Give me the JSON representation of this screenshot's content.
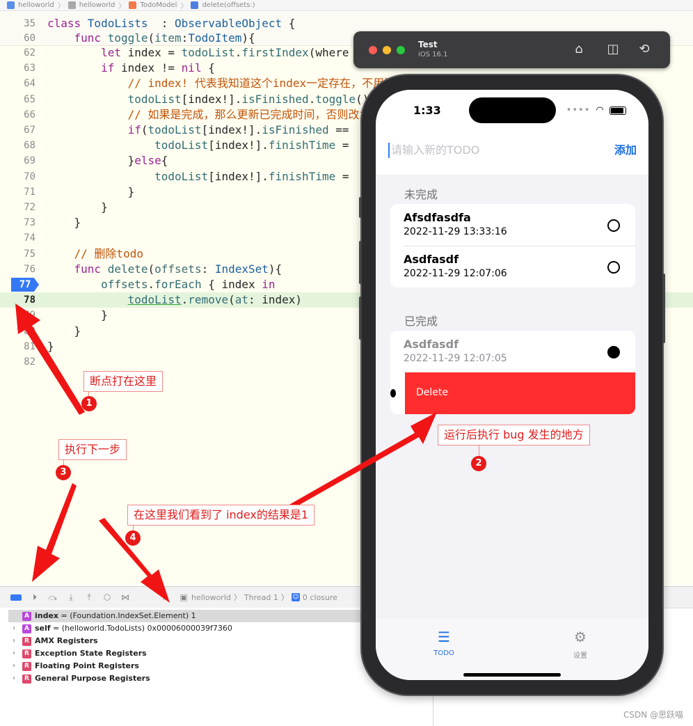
{
  "breadcrumb": {
    "items": [
      "helloworld",
      "helloworld",
      "TodoModel",
      "delete(offsets:)"
    ]
  },
  "editor": {
    "sticky_lines": [
      {
        "num": "35",
        "tokens": [
          [
            "kw",
            "class "
          ],
          [
            "ty",
            "TodoLists"
          ],
          [
            "",
            "  : "
          ],
          [
            "ty",
            "ObservableObject"
          ],
          [
            "",
            " {"
          ]
        ]
      },
      {
        "num": "60",
        "tokens": [
          [
            "",
            "    "
          ],
          [
            "kw",
            "func "
          ],
          [
            "fn",
            "toggle"
          ],
          [
            "",
            "("
          ],
          [
            "pm",
            "item"
          ],
          [
            "",
            ":"
          ],
          [
            "ty",
            "TodoItem"
          ],
          [
            "",
            "){"
          ]
        ]
      }
    ],
    "lines": [
      {
        "num": "62",
        "tokens": [
          [
            "",
            "        "
          ],
          [
            "kw",
            "let "
          ],
          [
            "",
            "index = "
          ],
          [
            "fn",
            "todoList"
          ],
          [
            "",
            "."
          ],
          [
            "fn",
            "firstIndex"
          ],
          [
            "",
            "(where"
          ]
        ]
      },
      {
        "num": "63",
        "tokens": [
          [
            "",
            "        "
          ],
          [
            "kw",
            "if "
          ],
          [
            "",
            "index != "
          ],
          [
            "kw",
            "nil"
          ],
          [
            "",
            " {"
          ]
        ]
      },
      {
        "num": "64",
        "tokens": [
          [
            "",
            "            "
          ],
          [
            "cm",
            "// index! 代表我知道这个index一定存在，不用再进行判断"
          ]
        ]
      },
      {
        "num": "65",
        "tokens": [
          [
            "",
            "            "
          ],
          [
            "fn",
            "todoList"
          ],
          [
            "",
            "[index!]."
          ],
          [
            "fn",
            "isFinished"
          ],
          [
            "",
            "."
          ],
          [
            "fn",
            "toggle"
          ],
          [
            "",
            "()"
          ]
        ]
      },
      {
        "num": "66",
        "tokens": [
          [
            "",
            "            "
          ],
          [
            "cm",
            "// 如果是完成，那么更新已完成时间，否则改为"
          ]
        ]
      },
      {
        "num": "67",
        "tokens": [
          [
            "",
            "            "
          ],
          [
            "kw",
            "if"
          ],
          [
            "",
            "("
          ],
          [
            "fn",
            "todoList"
          ],
          [
            "",
            "[index!]."
          ],
          [
            "fn",
            "isFinished"
          ],
          [
            "",
            " =="
          ]
        ]
      },
      {
        "num": "68",
        "tokens": [
          [
            "",
            "                "
          ],
          [
            "fn",
            "todoList"
          ],
          [
            "",
            "[index!]."
          ],
          [
            "fn",
            "finishTime"
          ],
          [
            "",
            " ="
          ]
        ]
      },
      {
        "num": "69",
        "tokens": [
          [
            "",
            "            "
          ],
          [
            "",
            "}"
          ],
          [
            "kw",
            "else"
          ],
          [
            "",
            "{"
          ]
        ]
      },
      {
        "num": "70",
        "tokens": [
          [
            "",
            "                "
          ],
          [
            "fn",
            "todoList"
          ],
          [
            "",
            "[index!]."
          ],
          [
            "fn",
            "finishTime"
          ],
          [
            "",
            " ="
          ]
        ]
      },
      {
        "num": "71",
        "tokens": [
          [
            "",
            "            }"
          ]
        ]
      },
      {
        "num": "72",
        "tokens": [
          [
            "",
            "        }"
          ]
        ]
      },
      {
        "num": "73",
        "tokens": [
          [
            "",
            "    }"
          ]
        ]
      },
      {
        "num": "74",
        "tokens": [
          [
            "",
            ""
          ]
        ]
      },
      {
        "num": "75",
        "tokens": [
          [
            "",
            "    "
          ],
          [
            "cm",
            "// 删除todo"
          ]
        ]
      },
      {
        "num": "76",
        "tokens": [
          [
            "",
            "    "
          ],
          [
            "kw",
            "func "
          ],
          [
            "fn",
            "delete"
          ],
          [
            "",
            "("
          ],
          [
            "pm",
            "offsets"
          ],
          [
            "",
            ": "
          ],
          [
            "ty",
            "IndexSet"
          ],
          [
            "",
            "){"
          ]
        ]
      },
      {
        "num": "77",
        "tokens": [
          [
            "",
            "        "
          ],
          [
            "fn",
            "offsets"
          ],
          [
            "",
            "."
          ],
          [
            "fn",
            "forEach"
          ],
          [
            "",
            " { index "
          ],
          [
            "kw",
            "in"
          ]
        ]
      },
      {
        "num": "78",
        "tokens": [
          [
            "",
            "            "
          ],
          [
            "fn",
            "todoList"
          ],
          [
            "",
            "."
          ],
          [
            "fn",
            "remove"
          ],
          [
            "",
            "("
          ],
          [
            "pm",
            "at"
          ],
          [
            "",
            ": index)"
          ]
        ]
      },
      {
        "num": "79",
        "tokens": [
          [
            "",
            "        }"
          ]
        ]
      },
      {
        "num": "80",
        "tokens": [
          [
            "",
            "    }"
          ]
        ]
      },
      {
        "num": "81",
        "tokens": [
          [
            "",
            "}"
          ]
        ]
      },
      {
        "num": "82",
        "tokens": [
          [
            "",
            ""
          ]
        ]
      }
    ],
    "breakpoint_line": "77",
    "current_line": "78"
  },
  "debug_toolbar": {
    "path": [
      "helloworld",
      "Thread 1",
      "0 closure"
    ]
  },
  "variables": [
    {
      "badge": "A",
      "color": "#b946d9",
      "name": "index",
      "value": " = (Foundation.IndexSet.Element) 1",
      "selected": true,
      "expandable": false
    },
    {
      "badge": "A",
      "color": "#b946d9",
      "name": "self",
      "value": " = (helloworld.TodoLists) 0x00006000039f7360",
      "selected": false,
      "expandable": true
    },
    {
      "badge": "R",
      "color": "#e0476a",
      "name": "AMX Registers",
      "value": "",
      "selected": false,
      "expandable": true
    },
    {
      "badge": "R",
      "color": "#e0476a",
      "name": "Exception State Registers",
      "value": "",
      "selected": false,
      "expandable": true
    },
    {
      "badge": "R",
      "color": "#e0476a",
      "name": "Floating Point Registers",
      "value": "",
      "selected": false,
      "expandable": true
    },
    {
      "badge": "R",
      "color": "#e0476a",
      "name": "General Purpose Registers",
      "value": "",
      "selected": false,
      "expandable": true
    }
  ],
  "simulator": {
    "title": "Test",
    "subtitle": "iOS 16.1",
    "status_time": "1:33",
    "input_placeholder": "请输入新的TODO",
    "add_label": "添加",
    "unfinished_header": "未完成",
    "finished_header": "已完成",
    "unfinished": [
      {
        "title": "Afsdfasdfa",
        "time": "2022-11-29 13:33:16"
      },
      {
        "title": "Asdfasdf",
        "time": "2022-11-29 12:07:06"
      }
    ],
    "finished": [
      {
        "title": "Asdfasdf",
        "time": "2022-11-29 12:07:05"
      }
    ],
    "delete_label": "Delete",
    "tabs": [
      {
        "label": "TODO",
        "icon": "list-icon",
        "active": true
      },
      {
        "label": "设置",
        "icon": "gear-icon",
        "active": false
      }
    ]
  },
  "annotations": {
    "note1": "断点打在这里",
    "note2": "运行后执行 bug 发生的地方",
    "note3": "执行下一步",
    "note4": "在这里我们看到了 index的结果是1",
    "n1": "1",
    "n2": "2",
    "n3": "3",
    "n4": "4"
  },
  "watermark": "CSDN @思跃喵",
  "colors": {
    "accent": "#3478f6",
    "delete_red": "#ff2d2d",
    "annotation_red": "#e01c1c"
  }
}
